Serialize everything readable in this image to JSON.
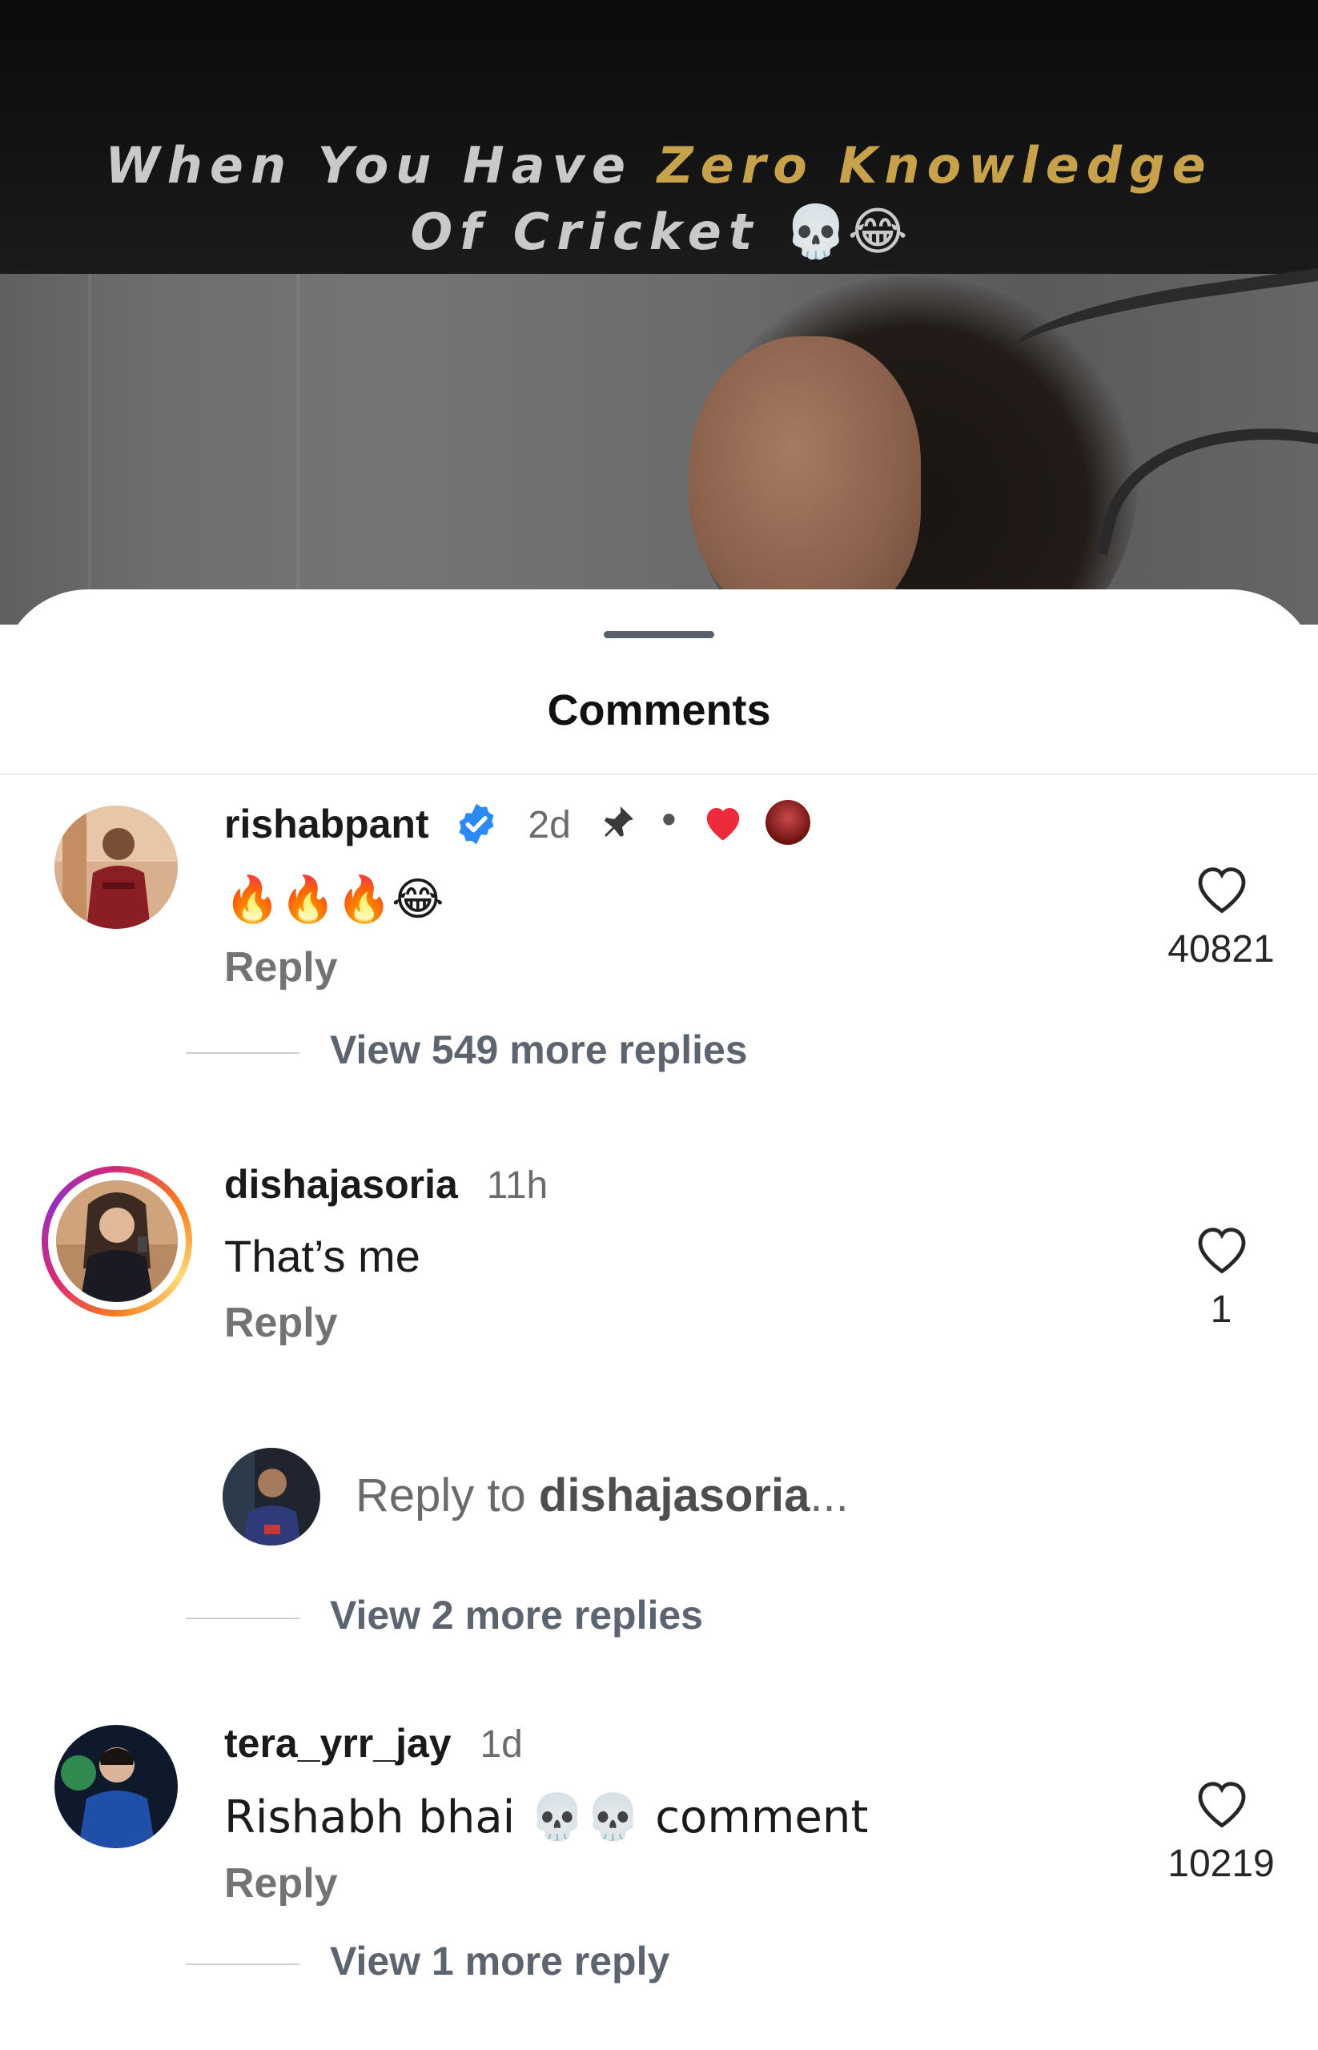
{
  "video": {
    "overlay_line1_plain": "When You Have ",
    "overlay_line1_accent": "Zero Knowledge",
    "overlay_line2": "Of Cricket ",
    "overlay_emojis": "💀😂"
  },
  "sheet": {
    "title": "Comments"
  },
  "comments": [
    {
      "username": "rishabpant",
      "time": "2d",
      "verified": true,
      "pinned": true,
      "text": "🔥🔥🔥😂",
      "reply_label": "Reply",
      "likes": "40821",
      "view_more": "View 549 more replies"
    },
    {
      "username": "dishajasoria",
      "time": "11h",
      "text": "That’s me",
      "reply_label": "Reply",
      "likes": "1",
      "view_more": "View 2 more replies"
    },
    {
      "username": "tera_yrr_jay",
      "time": "1d",
      "text": "Rishabh bhai 💀💀 comment",
      "reply_label": "Reply",
      "likes": "10219",
      "view_more": "View 1 more reply"
    }
  ],
  "reply_input": {
    "prefix": "Reply to ",
    "username": "dishajasoria",
    "suffix": "..."
  },
  "colors": {
    "accent_text": "#c8a24a",
    "verified_blue": "#2b8af6",
    "heart_red": "#ed2b3c"
  }
}
